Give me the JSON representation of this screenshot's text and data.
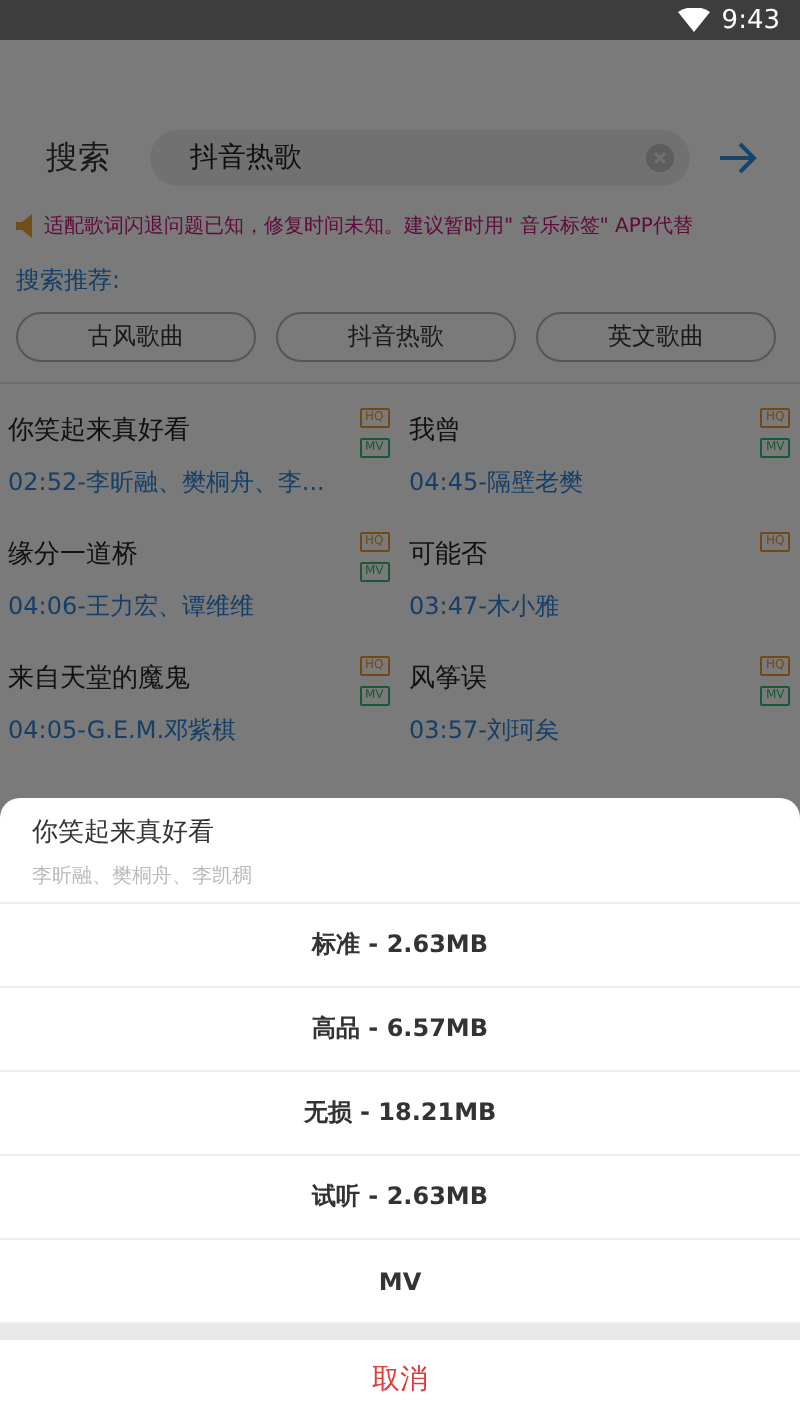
{
  "status_bar": {
    "time": "9:43"
  },
  "search": {
    "label": "搜索",
    "value": "抖音热歌"
  },
  "notice": "适配歌词闪退问题已知，修复时间未知。建议暂时用\" 音乐标签\" APP代替",
  "suggest_label": "搜索推荐:",
  "suggestions": [
    {
      "label": "古风歌曲"
    },
    {
      "label": "抖音热歌"
    },
    {
      "label": "英文歌曲"
    }
  ],
  "songs": [
    {
      "title": "你笑起来真好看",
      "subtitle": "02:52-李昕融、樊桐舟、李...",
      "badges": [
        {
          "kind": "quality",
          "label": "HQ"
        },
        {
          "kind": "mv",
          "label": "MV"
        }
      ]
    },
    {
      "title": "我曾",
      "subtitle": "04:45-隔壁老樊",
      "badges": [
        {
          "kind": "quality",
          "label": "HQ"
        },
        {
          "kind": "mv",
          "label": "MV"
        }
      ]
    },
    {
      "title": "缘分一道桥",
      "subtitle": "04:06-王力宏、谭维维",
      "badges": [
        {
          "kind": "quality",
          "label": "HQ"
        },
        {
          "kind": "mv",
          "label": "MV"
        }
      ]
    },
    {
      "title": "可能否",
      "subtitle": "03:47-木小雅",
      "badges": [
        {
          "kind": "quality",
          "label": "HQ"
        }
      ]
    },
    {
      "title": "来自天堂的魔鬼",
      "subtitle": "04:05-G.E.M.邓紫棋",
      "badges": [
        {
          "kind": "quality",
          "label": "HQ"
        },
        {
          "kind": "mv",
          "label": "MV"
        }
      ]
    },
    {
      "title": "风筝误",
      "subtitle": "03:57-刘珂矣",
      "badges": [
        {
          "kind": "quality",
          "label": "HQ"
        },
        {
          "kind": "mv",
          "label": "MV"
        }
      ]
    }
  ],
  "sheet": {
    "title": "你笑起来真好看",
    "artists": "李昕融、樊桐舟、李凯稠",
    "options": [
      {
        "label": "标准 - 2.63MB"
      },
      {
        "label": "高品 - 6.57MB"
      },
      {
        "label": "无损 - 18.21MB"
      },
      {
        "label": "试听 - 2.63MB"
      },
      {
        "label": "MV"
      }
    ],
    "cancel": "取消"
  }
}
